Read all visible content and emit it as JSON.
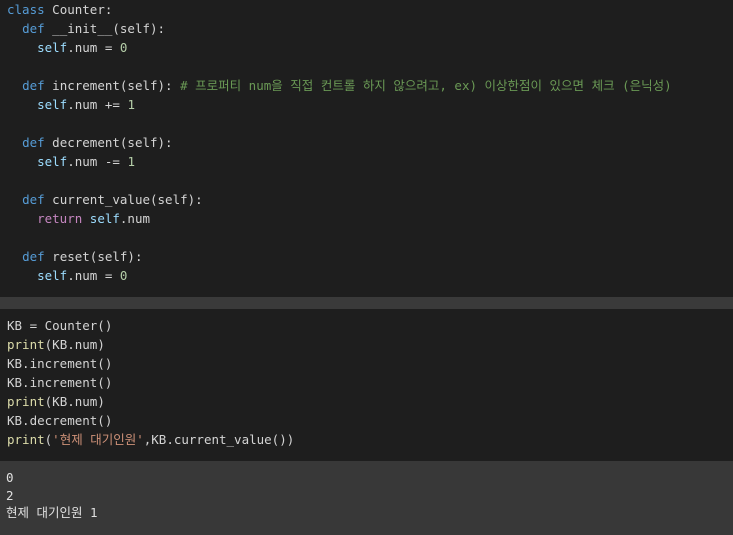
{
  "cell1": {
    "lines": [
      {
        "tokens": [
          {
            "t": "class",
            "c": "kw"
          },
          {
            "t": " Counter:",
            "c": "pl"
          }
        ]
      },
      {
        "tokens": [
          {
            "t": "  ",
            "c": "pl"
          },
          {
            "t": "def",
            "c": "kw"
          },
          {
            "t": " __init__(self):",
            "c": "pl"
          }
        ]
      },
      {
        "tokens": [
          {
            "t": "    ",
            "c": "pl"
          },
          {
            "t": "self",
            "c": "self"
          },
          {
            "t": ".num = ",
            "c": "pl"
          },
          {
            "t": "0",
            "c": "num"
          }
        ]
      },
      {
        "tokens": []
      },
      {
        "tokens": [
          {
            "t": "  ",
            "c": "pl"
          },
          {
            "t": "def",
            "c": "kw"
          },
          {
            "t": " increment(self): ",
            "c": "pl"
          },
          {
            "t": "# 프로퍼티 num을 직접 컨트롤 하지 않으려고, ex) 이상한점이 있으면 체크 (은닉성)",
            "c": "cmt"
          }
        ]
      },
      {
        "tokens": [
          {
            "t": "    ",
            "c": "pl"
          },
          {
            "t": "self",
            "c": "self"
          },
          {
            "t": ".num += ",
            "c": "pl"
          },
          {
            "t": "1",
            "c": "num"
          }
        ]
      },
      {
        "tokens": []
      },
      {
        "tokens": [
          {
            "t": "  ",
            "c": "pl"
          },
          {
            "t": "def",
            "c": "kw"
          },
          {
            "t": " decrement(self):",
            "c": "pl"
          }
        ]
      },
      {
        "tokens": [
          {
            "t": "    ",
            "c": "pl"
          },
          {
            "t": "self",
            "c": "self"
          },
          {
            "t": ".num -= ",
            "c": "pl"
          },
          {
            "t": "1",
            "c": "num"
          }
        ]
      },
      {
        "tokens": []
      },
      {
        "tokens": [
          {
            "t": "  ",
            "c": "pl"
          },
          {
            "t": "def",
            "c": "kw"
          },
          {
            "t": " current_value(self):",
            "c": "pl"
          }
        ]
      },
      {
        "tokens": [
          {
            "t": "    ",
            "c": "pl"
          },
          {
            "t": "return",
            "c": "ret"
          },
          {
            "t": " ",
            "c": "pl"
          },
          {
            "t": "self",
            "c": "self"
          },
          {
            "t": ".num",
            "c": "pl"
          }
        ]
      },
      {
        "tokens": []
      },
      {
        "tokens": [
          {
            "t": "  ",
            "c": "pl"
          },
          {
            "t": "def",
            "c": "kw"
          },
          {
            "t": " reset(self):",
            "c": "pl"
          }
        ]
      },
      {
        "tokens": [
          {
            "t": "    ",
            "c": "pl"
          },
          {
            "t": "self",
            "c": "self"
          },
          {
            "t": ".num = ",
            "c": "pl"
          },
          {
            "t": "0",
            "c": "num"
          }
        ]
      }
    ]
  },
  "cell2": {
    "lines": [
      {
        "tokens": [
          {
            "t": "KB = Counter()",
            "c": "pl"
          }
        ]
      },
      {
        "tokens": [
          {
            "t": "print",
            "c": "fn"
          },
          {
            "t": "(KB.num)",
            "c": "pl"
          }
        ]
      },
      {
        "tokens": [
          {
            "t": "KB.increment()",
            "c": "pl"
          }
        ]
      },
      {
        "tokens": [
          {
            "t": "KB.increment()",
            "c": "pl"
          }
        ]
      },
      {
        "tokens": [
          {
            "t": "print",
            "c": "fn"
          },
          {
            "t": "(KB.num)",
            "c": "pl"
          }
        ]
      },
      {
        "tokens": [
          {
            "t": "KB.decrement()",
            "c": "pl"
          }
        ]
      },
      {
        "tokens": [
          {
            "t": "print",
            "c": "fn"
          },
          {
            "t": "(",
            "c": "pl"
          },
          {
            "t": "'현제 대기인원'",
            "c": "str"
          },
          {
            "t": ",KB.current_value())",
            "c": "pl"
          }
        ]
      }
    ]
  },
  "output": {
    "lines": [
      "0",
      "2",
      "현제 대기인원 1"
    ]
  },
  "colors": {
    "keyword": "#569cd6",
    "function": "#dcdcaa",
    "self": "#9cdcfe",
    "number": "#b5cea8",
    "comment": "#6a9955",
    "string": "#ce9178",
    "return": "#c586c0",
    "background": "#1e1e1e",
    "output_background": "#383838"
  }
}
